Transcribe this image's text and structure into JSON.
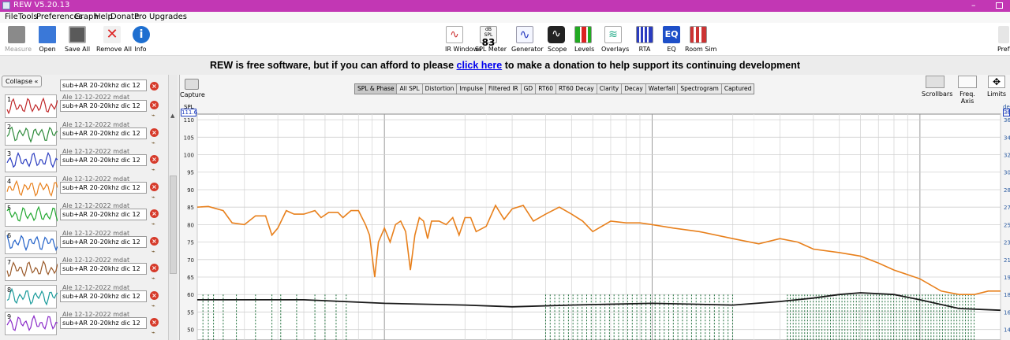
{
  "window": {
    "title": "REW V5.20.13",
    "colors": {
      "title_bar": "#c237b4",
      "spl_trace": "#e8801c",
      "phase_trace": "#1a1a1a",
      "impulse_trace": "#1e6e3a"
    }
  },
  "menu": [
    "File",
    "Tools",
    "Preferences",
    "Graph",
    "Help",
    "Donate",
    "Pro Upgrades"
  ],
  "toolbar_left": [
    {
      "label": "Measure",
      "icon": "microphone-icon"
    },
    {
      "label": "Open",
      "icon": "folder-icon"
    },
    {
      "label": "Save All",
      "icon": "save-icon"
    },
    {
      "label": "Remove All",
      "icon": "remove-icon"
    },
    {
      "label": "Info",
      "icon": "info-icon"
    }
  ],
  "toolbar_center": [
    {
      "label": "IR Windows",
      "icon": "ir-windows-icon"
    },
    {
      "label": "SPL Meter",
      "icon": "spl-meter-icon",
      "caption": "dB SPL",
      "value": "83"
    },
    {
      "label": "Generator",
      "icon": "generator-icon"
    },
    {
      "label": "Scope",
      "icon": "scope-icon"
    },
    {
      "label": "Levels",
      "icon": "levels-icon"
    },
    {
      "label": "Overlays",
      "icon": "overlays-icon"
    },
    {
      "label": "RTA",
      "icon": "rta-icon"
    },
    {
      "label": "EQ",
      "icon": "eq-icon",
      "caption": "EQ"
    },
    {
      "label": "Room Sim",
      "icon": "room-sim-icon"
    }
  ],
  "toolbar_right_cut": "Pref",
  "banner": {
    "before": "REW is free software, but if you can afford to please",
    "link": "click here",
    "after": "to make a donation to help support its continuing development"
  },
  "left_panel": {
    "collapse_label": "Collapse «",
    "first_name": "sub+AR 20-20khz dic 12",
    "measurements": [
      {
        "num": "1",
        "date": "Ale 12-12-2022 mdat",
        "name": "sub+AR 20-20khz dic 12",
        "color": "#c0282a"
      },
      {
        "num": "2",
        "date": "Ale 12-12-2022 mdat",
        "name": "sub+AR 20-20khz dic 12",
        "color": "#2d8a3a"
      },
      {
        "num": "3",
        "date": "Ale 12-12-2022 mdat",
        "name": "sub+AR 20-20khz dic 12",
        "color": "#2a3cc0"
      },
      {
        "num": "4",
        "date": "Ale 12-12-2022 mdat",
        "name": "sub+AR 20-20khz dic 12",
        "color": "#e8801c"
      },
      {
        "num": "5",
        "date": "Ale 12-12-2022 mdat",
        "name": "sub+AR 20-20khz dic 12",
        "color": "#22a830"
      },
      {
        "num": "6",
        "date": "Ale 12-12-2022 mdat",
        "name": "sub+AR 20-20khz dic 12",
        "color": "#2060c8"
      },
      {
        "num": "7",
        "date": "Ale 12-12-2022 mdat",
        "name": "sub+AR 20-20khz dic 12",
        "color": "#9a5a2a"
      },
      {
        "num": "8",
        "date": "Ale 12-12-2022 mdat",
        "name": "sub+AR 20-20khz dic 12",
        "color": "#189a9a"
      },
      {
        "num": "9",
        "date": "Ale 12-12-2022 mdat",
        "name": "sub+AR 20-20khz dic 12",
        "color": "#8a2ac8"
      }
    ]
  },
  "graph": {
    "capture_label": "Capture",
    "tabs": [
      "SPL & Phase",
      "All SPL",
      "Distortion",
      "Impulse",
      "Filtered IR",
      "GD",
      "RT60",
      "RT60 Decay",
      "Clarity",
      "Decay",
      "Waterfall",
      "Spectrogram",
      "Captured"
    ],
    "selected_tab": "SPL & Phase",
    "right_tools": [
      {
        "label": "Scrollbars",
        "icon": "scrollbars-icon"
      },
      {
        "label": "Freq. Axis",
        "icon": "freq-axis-icon"
      },
      {
        "label": "Limits",
        "icon": "limits-icon"
      }
    ],
    "y_axis_label": "SPL",
    "y_axis_value": "111.6",
    "right_axis_label": "de",
    "right_axis_value": "36",
    "y_ticks": [
      "110",
      "105",
      "100",
      "95",
      "90",
      "85",
      "80",
      "75",
      "70",
      "65",
      "60",
      "55",
      "50"
    ],
    "right_ticks": [
      "36",
      "34",
      "32",
      "30",
      "28",
      "27",
      "25",
      "23",
      "21",
      "19",
      "18",
      "16",
      "14"
    ]
  },
  "chart_data": {
    "type": "line",
    "ylabel": "SPL",
    "ylim": [
      47,
      111.6
    ],
    "x_scale": "log",
    "grid": true,
    "series": [
      {
        "x": [
          20,
          22,
          25,
          27,
          30,
          33,
          36,
          38,
          40,
          43,
          46,
          50,
          55,
          58,
          62,
          67,
          70,
          75,
          80,
          85,
          88,
          92,
          95,
          100,
          105,
          110,
          115,
          120,
          125,
          130,
          135,
          140,
          145,
          150,
          160,
          170,
          180,
          190,
          200,
          210,
          220,
          240,
          260,
          280,
          300,
          330,
          360,
          400,
          450,
          500,
          550,
          600,
          700,
          800,
          900,
          1000,
          1200,
          1500,
          2000,
          2500,
          3000,
          3500,
          4000,
          5000,
          6000,
          7000,
          8000,
          10000,
          12000,
          14000,
          16000,
          18000,
          20000
        ],
        "y": [
          85,
          85.2,
          84,
          80.5,
          80,
          82.5,
          82.5,
          77,
          79,
          84,
          83,
          83,
          84,
          82,
          83.5,
          83.5,
          82,
          84,
          84,
          80,
          77,
          65,
          75,
          79,
          75,
          80,
          81,
          78,
          67,
          77,
          82,
          81,
          76,
          81,
          81,
          80,
          82,
          77,
          82,
          82,
          78,
          79.5,
          85.5,
          81.5,
          84.5,
          85.5,
          81,
          83,
          85,
          83,
          81,
          78,
          81,
          80.5,
          80.5,
          80,
          79,
          78,
          76,
          74.5,
          76,
          75,
          73,
          72,
          71,
          69,
          67,
          64.5,
          61,
          60,
          60,
          61,
          61
        ]
      },
      {
        "x": [
          20,
          50,
          100,
          200,
          300,
          500,
          1000,
          2000,
          3000,
          4000,
          5000,
          6000,
          8000,
          10000,
          14000,
          20000
        ],
        "y": [
          58.5,
          58.5,
          57.5,
          57,
          56.5,
          57,
          57.5,
          57,
          58,
          59,
          60,
          60.5,
          60,
          58.5,
          56,
          55.5
        ]
      }
    ]
  }
}
